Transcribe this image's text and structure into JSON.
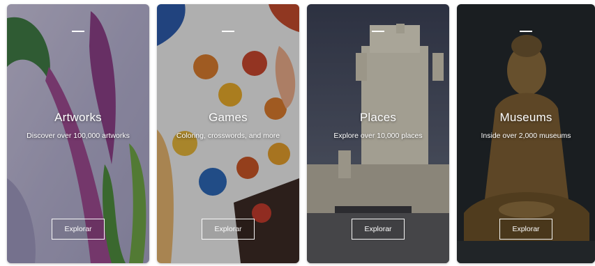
{
  "cards": [
    {
      "title": "Artworks",
      "subtitle": "Discover over 100,000 artworks",
      "button": "Explorar",
      "image": "painting-flower"
    },
    {
      "title": "Games",
      "subtitle": "Coloring, crosswords, and more",
      "button": "Explorar",
      "image": "puzzle-pieces"
    },
    {
      "title": "Places",
      "subtitle": "Explore over 10,000 places",
      "button": "Explorar",
      "image": "tower-photo"
    },
    {
      "title": "Museums",
      "subtitle": "Inside over 2,000 museums",
      "button": "Explorar",
      "image": "buddha-statue"
    }
  ],
  "colors": {
    "text": "#ffffff",
    "button_border": "#ffffff"
  }
}
